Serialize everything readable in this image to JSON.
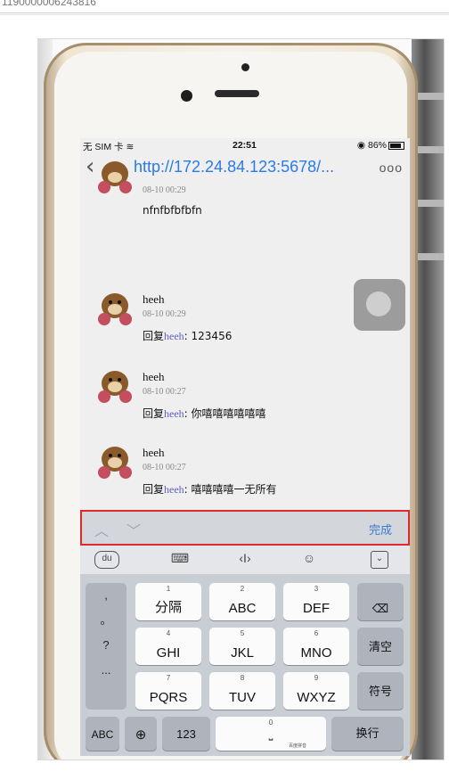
{
  "page": {
    "header_id": "1190000006243816"
  },
  "status_bar": {
    "carrier": "无 SIM 卡",
    "wifi_icon": "wifi-icon",
    "time": "22:51",
    "battery": "86%"
  },
  "nav": {
    "back_icon": "chevron-left-icon",
    "url": "http://172.24.84.123:5678/...",
    "more_label": "ooo"
  },
  "comments": [
    {
      "name": "",
      "time": "08-10 00:29",
      "text": "nfnfbfbfbfn",
      "reply_prefix": "",
      "reply_to": ""
    },
    {
      "name": "heeh",
      "time": "08-10 00:29",
      "reply_prefix": "回复",
      "reply_to": "heeh",
      "text": ": 123456"
    },
    {
      "name": "heeh",
      "time": "08-10 00:27",
      "reply_prefix": "回复",
      "reply_to": "heeh",
      "text": ": 你嘻嘻嘻嘻嘻嘻"
    },
    {
      "name": "heeh",
      "time": "08-10 00:27",
      "reply_prefix": "回复",
      "reply_to": "heeh",
      "text": ": 嘻嘻嘻嘻一无所有"
    }
  ],
  "toolbar": {
    "up_icon": "chevron-up-icon",
    "down_icon": "chevron-down-icon",
    "done_label": "完成",
    "highlight_color": "#e0292c"
  },
  "ime_bar": {
    "du_label": "du",
    "cursor_label": "‹I›"
  },
  "keyboard": {
    "punct": [
      ",",
      "。",
      "?",
      "..."
    ],
    "keys": [
      {
        "num": "1",
        "label": "分隔"
      },
      {
        "num": "2",
        "label": "ABC"
      },
      {
        "num": "3",
        "label": "DEF"
      },
      {
        "num": "4",
        "label": "GHI"
      },
      {
        "num": "5",
        "label": "JKL"
      },
      {
        "num": "6",
        "label": "MNO"
      },
      {
        "num": "7",
        "label": "PQRS"
      },
      {
        "num": "8",
        "label": "TUV"
      },
      {
        "num": "9",
        "label": "WXYZ"
      }
    ],
    "side_keys": {
      "delete_icon": "backspace-icon",
      "clear": "清空",
      "symbol": "符号"
    },
    "bottom": {
      "abc": "ABC",
      "globe_icon": "globe-icon",
      "num123": "123",
      "space_num": "0",
      "space_brand": "百度拼音",
      "enter": "换行"
    }
  }
}
